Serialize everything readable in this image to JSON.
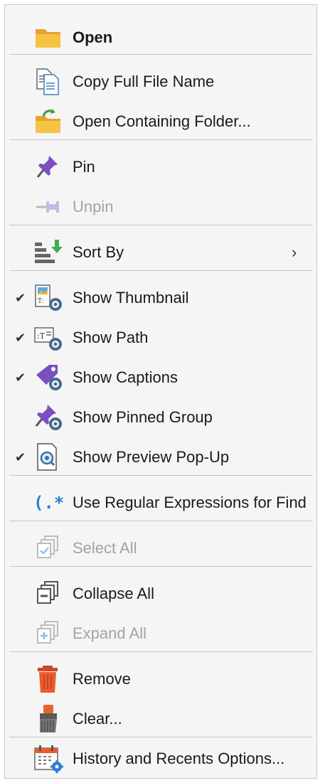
{
  "menu": {
    "open": "Open",
    "copy_full_file_name": "Copy Full File Name",
    "open_containing_folder": "Open Containing Folder...",
    "pin": "Pin",
    "unpin": "Unpin",
    "sort_by": "Sort By",
    "show_thumbnail": "Show Thumbnail",
    "show_path": "Show Path",
    "show_captions": "Show Captions",
    "show_pinned_group": "Show Pinned Group",
    "show_preview_popup": "Show Preview Pop-Up",
    "use_regex": "Use Regular Expressions for Find",
    "select_all": "Select All",
    "collapse_all": "Collapse All",
    "expand_all": "Expand All",
    "remove": "Remove",
    "clear": "Clear...",
    "history_options": "History and Recents Options..."
  },
  "checks": {
    "show_thumbnail": true,
    "show_path": true,
    "show_captions": true,
    "show_pinned_group": false,
    "show_preview_popup": true
  },
  "disabled": [
    "unpin",
    "select_all",
    "expand_all"
  ],
  "glyphs": {
    "check": "✔",
    "submenu": "›"
  },
  "icons": {
    "open": "folder-icon",
    "copy_full_file_name": "copy-document-icon",
    "open_containing_folder": "folder-arrow-icon",
    "pin": "pin-icon",
    "unpin": "unpin-icon",
    "sort_by": "sort-icon",
    "show_thumbnail": "thumbnail-view-icon",
    "show_path": "path-view-icon",
    "show_captions": "captions-view-icon",
    "show_pinned_group": "pinned-group-view-icon",
    "show_preview_popup": "preview-popup-icon",
    "use_regex": "regex-icon",
    "select_all": "select-all-icon",
    "collapse_all": "collapse-all-icon",
    "expand_all": "expand-all-icon",
    "remove": "trash-icon",
    "clear": "brush-icon",
    "history_options": "calendar-settings-icon"
  },
  "colors": {
    "background": "#f5f5f5",
    "text": "#1a1a1a",
    "disabled_text": "#a3a3a3",
    "separator": "#c6c6c6",
    "folder": "#f2b53b",
    "pin": "#7b4fc0",
    "remove": "#e25a2b",
    "accent_blue": "#2a7fd6"
  }
}
